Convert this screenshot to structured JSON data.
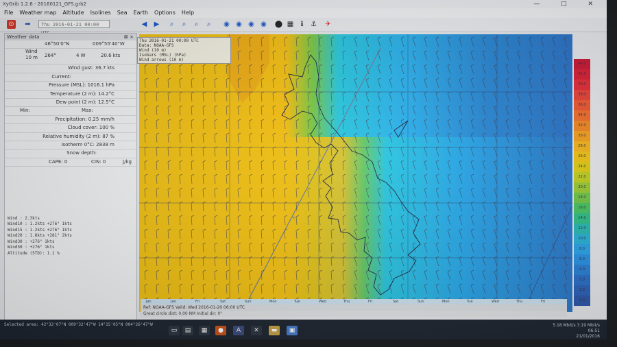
{
  "window": {
    "title": "XyGrib 1.2.6 - 20160121_GFS.grb2",
    "controls": "— □ ✕"
  },
  "menu": [
    "File",
    "Weather map",
    "Altitude",
    "Isolines",
    "Sea",
    "Earth",
    "Options",
    "Help"
  ],
  "toolbar": {
    "datetime": "Thu 2016-01-21 00:00 UTC"
  },
  "panel": {
    "title": "Weather data",
    "close": "⊠ ×",
    "lat": "46°50'0\"N",
    "lon": "009°55'40\"W",
    "wind_label": "Wind 10 m",
    "wind_dir": "264°",
    "wind_sector": "4 W",
    "wind_speed": "20.6 kts",
    "wind_gust": "Wind gust: 36.7 kts",
    "current": "Current:",
    "pressure": "Pressure (MSL): 1016.1 hPa",
    "temperature": "Temperature (2 m): 14.2°C",
    "dewpoint": "Dew point (2 m): 12.5°C",
    "min": "Min:",
    "max": "Max:",
    "precip": "Precipitation: 0.25 mm/h",
    "cloud": "Cloud cover: 100 %",
    "humidity": "Relative humidity (2 m): 87 %",
    "isotherm": "Isotherm 0°C: 2838 m",
    "snow": "Snow depth:",
    "cape": "CAPE: 0",
    "cin": "CIN: 0",
    "jkg": "J/kg",
    "bottom": [
      "Wind : 2.3kts",
      "Wind10 : 1.2kts +276° 1kts",
      "Wind15 : 1.2kts +276° 1kts",
      "Wind20 : 1.8kts +281° 2kts",
      "Wind30 :        +276° 1kts",
      "Wind50 :        +276° 1kts",
      "Altitude (STD): 1.1 %"
    ]
  },
  "legend": [
    "Thu 2016-01-21 00:00 UTC",
    "Data: NOAA-GFS",
    "Wind (10 m)",
    "Isobars (MSL) (hPa)",
    "Wind arrows (10 m)"
  ],
  "timebar": {
    "labels": [
      "Jan",
      "Jan",
      "Fri",
      "Sat",
      "Sun",
      "Mon",
      "Tue",
      "Wed",
      "Thu",
      "Fri",
      "Sat",
      "Sun",
      "Mon",
      "Tue",
      "Wed",
      "Thu",
      "Fri"
    ]
  },
  "status": {
    "line1": "Ref: NOAA-GFS   Valid: Wed 2016-01-20 06:00 UTC",
    "line2": "Great circle dist: 0.00 NM   Initial dir: 0°"
  },
  "taskbar": {
    "selected": "Selected area: 42°32'07\"N 009°32'47\"W 14°15'05\"N 004°26'47\"W",
    "tray_time": "06:51",
    "tray_date": "21/01/2016",
    "tray_info": "5.18 Mbit/s  3.19 Mbit/s"
  },
  "scale_labels": [
    "44.0",
    "42.0",
    "40.0",
    "38.0",
    "36.0",
    "34.0",
    "32.0",
    "30.0",
    "28.0",
    "26.0",
    "24.0",
    "22.0",
    "20.0",
    "18.0",
    "16.0",
    "14.0",
    "12.0",
    "10.0",
    "8.0",
    "6.0",
    "4.0",
    "2.0",
    "1.0",
    "0.0"
  ],
  "colors": {
    "yellow": "#f0c418",
    "orange": "#e8a21a",
    "green": "#62c34f",
    "cyan": "#2ab4e8",
    "blue": "#2a6fc0"
  }
}
